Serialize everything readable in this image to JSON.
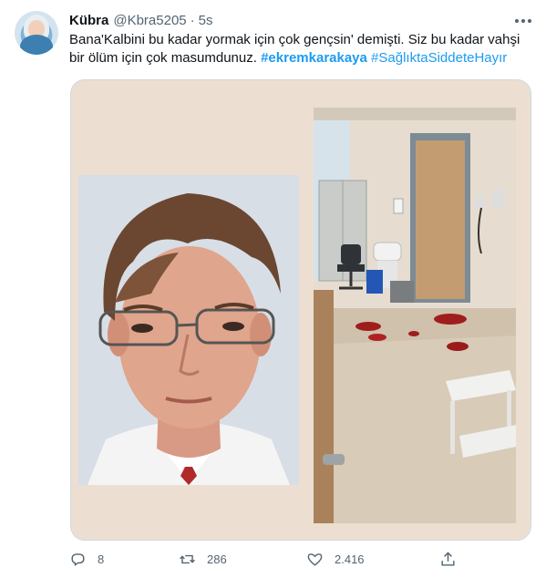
{
  "tweet": {
    "author_name": "Kübra",
    "author_handle": "@Kbra5205",
    "separator": "·",
    "time": "5s",
    "text_part1": "Bana'Kalbini bu kadar yormak için çok gençsin' demişti. Siz bu kadar vahşi bir ölüm için çok masumdunuz. ",
    "hashtag1": "#ekremkarakaya",
    "hashtag2": "#SağlıktaSiddeteHayır"
  },
  "actions": {
    "reply_count": "8",
    "retweet_count": "286",
    "like_count": "2.416"
  },
  "icons": {
    "more": "more-dots-icon",
    "reply": "reply-icon",
    "retweet": "retweet-icon",
    "like": "heart-icon",
    "share": "share-icon"
  },
  "colors": {
    "link": "#1d9bf0",
    "secondary_text": "#536471",
    "media_background": "#ecdfd2"
  }
}
